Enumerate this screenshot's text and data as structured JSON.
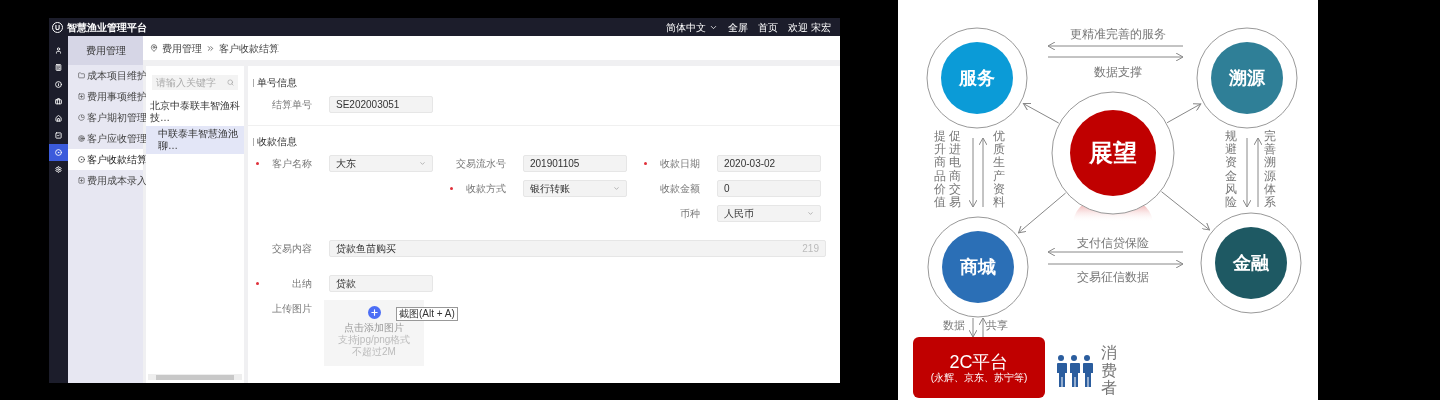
{
  "app": {
    "logo": "U",
    "title": "智慧渔业管理平台",
    "language": "简体中文",
    "header_links": [
      "全屏",
      "首页",
      "欢迎 宋宏"
    ],
    "rail": [
      {
        "selected": false
      },
      {
        "selected": false
      },
      {
        "selected": false
      },
      {
        "selected": false
      },
      {
        "selected": false
      },
      {
        "selected": false
      },
      {
        "selected": true
      },
      {
        "selected": false
      }
    ],
    "menu": {
      "title": "费用管理",
      "items": [
        {
          "label": "成本项目维护",
          "selected": false
        },
        {
          "label": "费用事项维护",
          "selected": false
        },
        {
          "label": "客户期初管理",
          "selected": false
        },
        {
          "label": "客户应收管理",
          "selected": false
        },
        {
          "label": "客户收款结算",
          "selected": true
        },
        {
          "label": "费用成本录入",
          "selected": false
        }
      ]
    },
    "breadcrumb": [
      "费用管理",
      "客户收款结算"
    ],
    "tree": {
      "placeholder": "请输入关键字",
      "nodes": [
        {
          "label": "北京中泰联丰智渔科技…",
          "selected": false,
          "children": [
            {
              "label": "中联泰丰智慧渔池聊…",
              "selected": true
            }
          ]
        }
      ]
    },
    "form": {
      "sections": [
        {
          "title": "单号信息",
          "rows": [
            [
              {
                "label": "结算单号",
                "kind": "text",
                "value": "SE202003051",
                "required": false
              }
            ]
          ]
        },
        {
          "title": "收款信息",
          "rows": [
            [
              {
                "label": "客户名称",
                "kind": "select",
                "value": "大东",
                "required": true
              },
              {
                "label": "交易流水号",
                "kind": "text",
                "value": "201901105",
                "required": false
              },
              {
                "label": "收款日期",
                "kind": "text",
                "value": "2020-03-02",
                "required": true
              }
            ],
            [
              null,
              {
                "label": "收款方式",
                "kind": "select",
                "value": "银行转账",
                "required": true
              },
              {
                "label": "收款金额",
                "kind": "text",
                "value": "0",
                "required": false
              }
            ],
            [
              null,
              null,
              {
                "label": "币种",
                "kind": "select",
                "value": "人民币",
                "required": false
              }
            ],
            [
              {
                "label": "交易内容",
                "kind": "wide",
                "value": "贷款鱼苗购买",
                "counter": "219",
                "required": false
              }
            ],
            [
              {
                "label": "出纳",
                "kind": "text",
                "value": "贷款",
                "required": true
              }
            ],
            [
              {
                "label": "上传图片",
                "kind": "upload",
                "hint": "点击添加图片",
                "notes": [
                  "支持jpg/png格式",
                  "不超过2M"
                ],
                "required": false
              }
            ]
          ]
        }
      ]
    },
    "tooltip": "截图(Alt + A)"
  },
  "diagram": {
    "center": {
      "label": "展望",
      "color": "#c00000"
    },
    "nodes": [
      {
        "label": "服务",
        "color": "#0b9bd7"
      },
      {
        "label": "溯源",
        "color": "#2f7f97"
      },
      {
        "label": "商城",
        "color": "#2b6fb6"
      },
      {
        "label": "金融",
        "color": "#1e5963"
      }
    ],
    "top_links": [
      "更精准完善的服务",
      "数据支撑"
    ],
    "bottom_links": [
      "支付信贷保险",
      "交易征信数据"
    ],
    "left_columns": [
      "提升商品价值",
      "促进电商交易",
      "优质生产资料"
    ],
    "right_columns": [
      "规避资金风险",
      "完善溯源体系"
    ],
    "share_labels": [
      "数据",
      "共享"
    ],
    "platform": {
      "title": "2C平台",
      "subtitle": "(永辉、京东、苏宁等)"
    },
    "consumer": "消费者"
  }
}
